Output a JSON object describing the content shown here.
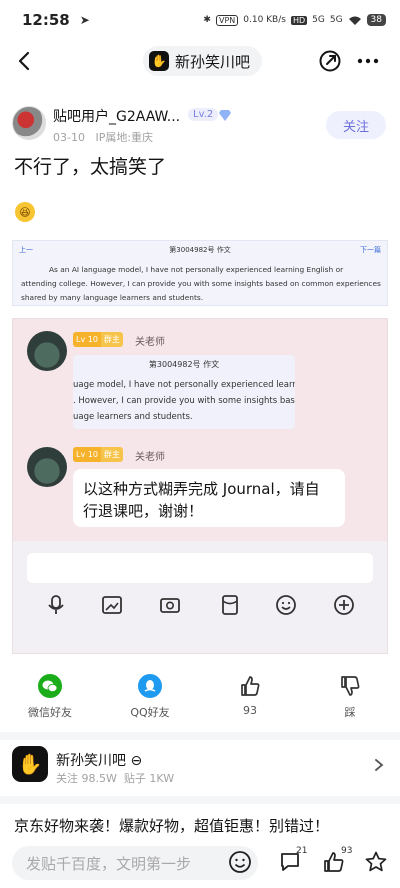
{
  "status_bar": {
    "time": "12:58",
    "vpn": "VPN",
    "speed": "0.10 KB/s",
    "hd": "HD",
    "net1": "5G",
    "net2": "5G",
    "battery": "38"
  },
  "nav": {
    "forum_name": "新孙笑川吧"
  },
  "post": {
    "author_name": "贴吧用户_G2AAW...",
    "level": "Lv.2",
    "date": "03-10",
    "ip_location": "IP属地:重庆",
    "follow_label": "关注",
    "title": "不行了，太搞笑了"
  },
  "image1": {
    "prev": "上一",
    "next": "下一篇",
    "heading": "第3004982号 作文",
    "line1": "As an AI language model, I have not personally experienced learning English or",
    "line2": "attending college. However, I can provide you with some insights based on common experiences",
    "line3": "shared by many language learners and students."
  },
  "image2": {
    "msg1": {
      "lv": "Lv 10",
      "role": "群主",
      "sender": "关老师",
      "quote_title": "第3004982号 作文",
      "quote_line1": "uage model, I have not personally experienced learning E",
      "quote_line2": ". However, I can provide you with some insights based c",
      "quote_line3": "uage learners and students."
    },
    "msg2": {
      "lv": "Lv 10",
      "role": "群主",
      "sender": "关老师",
      "text_line1": "以这种方式糊弄完成 Journal，请自",
      "text_line2": "行退课吧，谢谢！"
    }
  },
  "actions": {
    "wechat": "微信好友",
    "qq": "QQ好友",
    "like_count": "93",
    "dislike": "踩"
  },
  "forum_card": {
    "name": "新孙笑川吧",
    "followers": "关注 98.5W",
    "posts": "贴子 1KW"
  },
  "promo": "京东好物来袭！爆款好物，超值钜惠！别错过！",
  "bottom_bar": {
    "placeholder": "发贴千百度，文明第一步",
    "comment_count": "21",
    "like_count": "93"
  },
  "colors": {
    "accent": "#6d71dd",
    "wechat_green": "#1aad19",
    "qq_blue": "#1e9bf0"
  }
}
